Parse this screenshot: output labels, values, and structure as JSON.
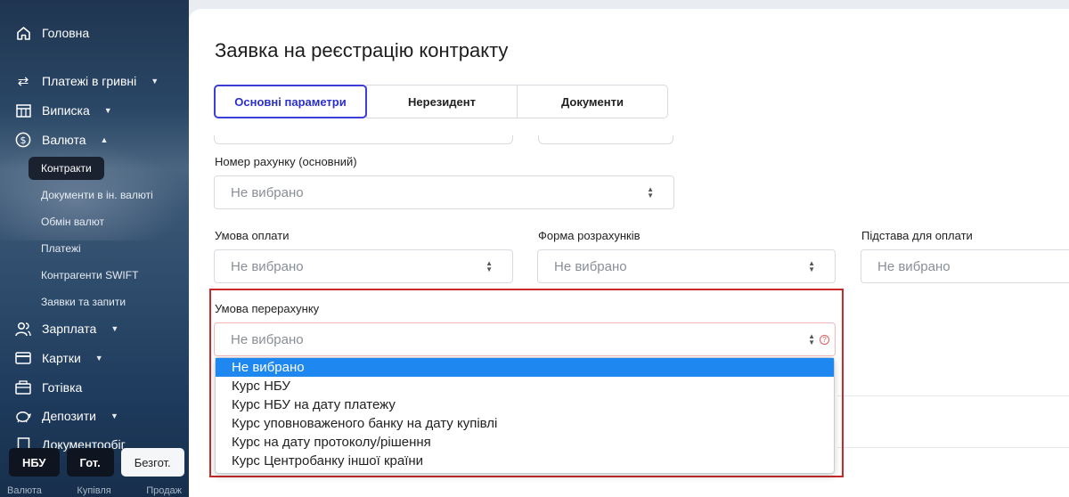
{
  "sidebar": {
    "home": "Головна",
    "payments_uah": "Платежі в гривні",
    "statement": "Виписка",
    "currency": "Валюта",
    "currency_sub": [
      "Контракти",
      "Документи в ін. валюті",
      "Обмін валют",
      "Платежі",
      "Контрагенти SWIFT",
      "Заявки та запити"
    ],
    "salary": "Зарплата",
    "cards": "Картки",
    "cash": "Готівка",
    "deposits": "Депозити",
    "docflow": "Документообіг",
    "fx_buttons": [
      "НБУ",
      "Гот.",
      "Безгот."
    ],
    "fx_footer": [
      "Валюта",
      "Купівля",
      "Продаж"
    ]
  },
  "page": {
    "title": "Заявка на реєстрацію контракту",
    "tabs": [
      "Основні параметри",
      "Нерезидент",
      "Документи"
    ]
  },
  "form": {
    "account_label": "Номер рахунку (основний)",
    "account_value": "Не вибрано",
    "payment_terms_label": "Умова оплати",
    "payment_terms_value": "Не вибрано",
    "settlement_form_label": "Форма розрахунків",
    "settlement_form_value": "Не вибрано",
    "payment_basis_label": "Підстава для оплати",
    "payment_basis_value": "Не вибрано",
    "recalc_label": "Умова перерахунку",
    "recalc_value": "Не вибрано",
    "recalc_options": [
      "Не вибрано",
      "Курс НБУ",
      "Курс НБУ на дату платежу",
      "Курс уповноваженого банку на дату купівлі",
      "Курс на дату протоколу/рішення",
      "Курс Центробанку іншої країни"
    ]
  },
  "colors": {
    "accent": "#3b3fd6",
    "highlight_border": "#c82a2a",
    "dropdown_selected": "#1e88f0"
  }
}
